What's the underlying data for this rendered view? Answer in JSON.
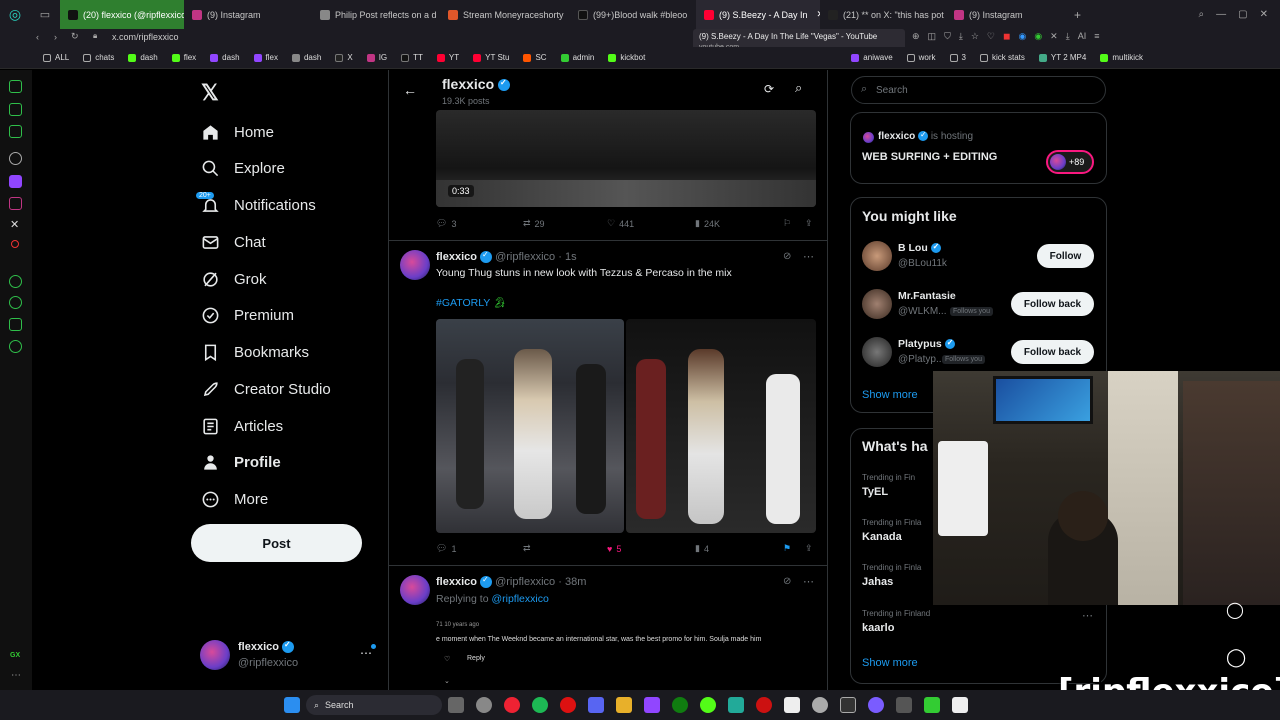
{
  "browser": {
    "tabs": [
      {
        "label": "(20) flexxico (@ripflexxico",
        "color": "#2f7f2f"
      },
      {
        "label": "(9) Instagram",
        "color": "#c13584"
      },
      {
        "label": "Philip Post reflects on a d",
        "color": "#888888"
      },
      {
        "label": "Stream Moneyraceshorty",
        "color": "#e0572a"
      },
      {
        "label": "(99+)Blood walk #bleoo",
        "color": "#111111"
      },
      {
        "label": "(9) S.Beezy - A Day In",
        "color": "#ff0033"
      },
      {
        "label": "(21) ** on X: \"this has pot",
        "color": "#222222"
      },
      {
        "label": "(9) Instagram",
        "color": "#c13584"
      }
    ],
    "url": "x.com/ripflexxico",
    "tooltip_title": "(9) S.Beezy - A Day In The Life \"Vegas\" - YouTube",
    "tooltip_domain": "youtube.com",
    "bookmarks": [
      "ALL",
      "chats",
      "dash",
      "flex",
      "dash",
      "flex",
      "dash",
      "X",
      "IG",
      "TT",
      "YT",
      "YT Stu",
      "SC",
      "admin",
      "kickbot"
    ],
    "bookmarks_right": [
      "aniwave",
      "work",
      "3",
      "kick stats",
      "YT 2 MP4",
      "multikick"
    ]
  },
  "nav": {
    "items": [
      "Home",
      "Explore",
      "Notifications",
      "Chat",
      "Grok",
      "Premium",
      "Bookmarks",
      "Creator Studio",
      "Articles",
      "Profile",
      "More"
    ],
    "notif_badge": "20+",
    "post_label": "Post",
    "account_name": "flexxico",
    "account_handle": "@ripflexxico"
  },
  "header": {
    "name": "flexxico",
    "posts": "19.3K posts"
  },
  "video_post": {
    "duration": "0:33",
    "replies": "3",
    "reposts": "29",
    "likes": "441",
    "views": "24K"
  },
  "post1": {
    "name": "flexxico",
    "handle": "@ripflexxico",
    "time": "· 1s",
    "text": "Young Thug stuns in new look with Tezzus & Percaso in the mix",
    "hashtag": "#GATORLY",
    "replies": "1",
    "likes": "5",
    "views": "4"
  },
  "post2": {
    "name": "flexxico",
    "handle": "@ripflexxico",
    "time": "· 38m",
    "replying_prefix": "Replying to",
    "replying_to": "@ripflexxico",
    "quoted_meta": "71 10 years ago",
    "quoted_text": "e moment when The Weeknd became an international star, was the best promo for him. Soulja made him",
    "quoted_reply": "Reply"
  },
  "right": {
    "search_placeholder": "Search",
    "space_host": "flexxico",
    "space_hosting": "is hosting",
    "space_title": "WEB SURFING + EDITING",
    "space_count": "+89",
    "wtf_title": "You might like",
    "suggestions": [
      {
        "name": "B Lou",
        "handle": "@BLou11k",
        "button": "Follow",
        "follows_you": ""
      },
      {
        "name": "Mr.Fantasie",
        "handle": "@WLKM...",
        "button": "Follow back",
        "follows_you": "Follows you"
      },
      {
        "name": "Platypus",
        "handle": "@Platyp...",
        "button": "Follow back",
        "follows_you": "Follows you"
      }
    ],
    "show_more": "Show more",
    "trends_title": "What's ha",
    "trends": [
      {
        "context": "Trending in Fin",
        "name": "TyEL"
      },
      {
        "context": "Trending in Finla",
        "name": "Kanada"
      },
      {
        "context": "Trending in Finla",
        "name": "Jahas"
      },
      {
        "context": "Trending in Finland",
        "name": "kaarlo"
      }
    ],
    "show_more_2": "Show more"
  },
  "taskbar": {
    "search": "Search"
  },
  "overlay": "[ripflexxico]"
}
